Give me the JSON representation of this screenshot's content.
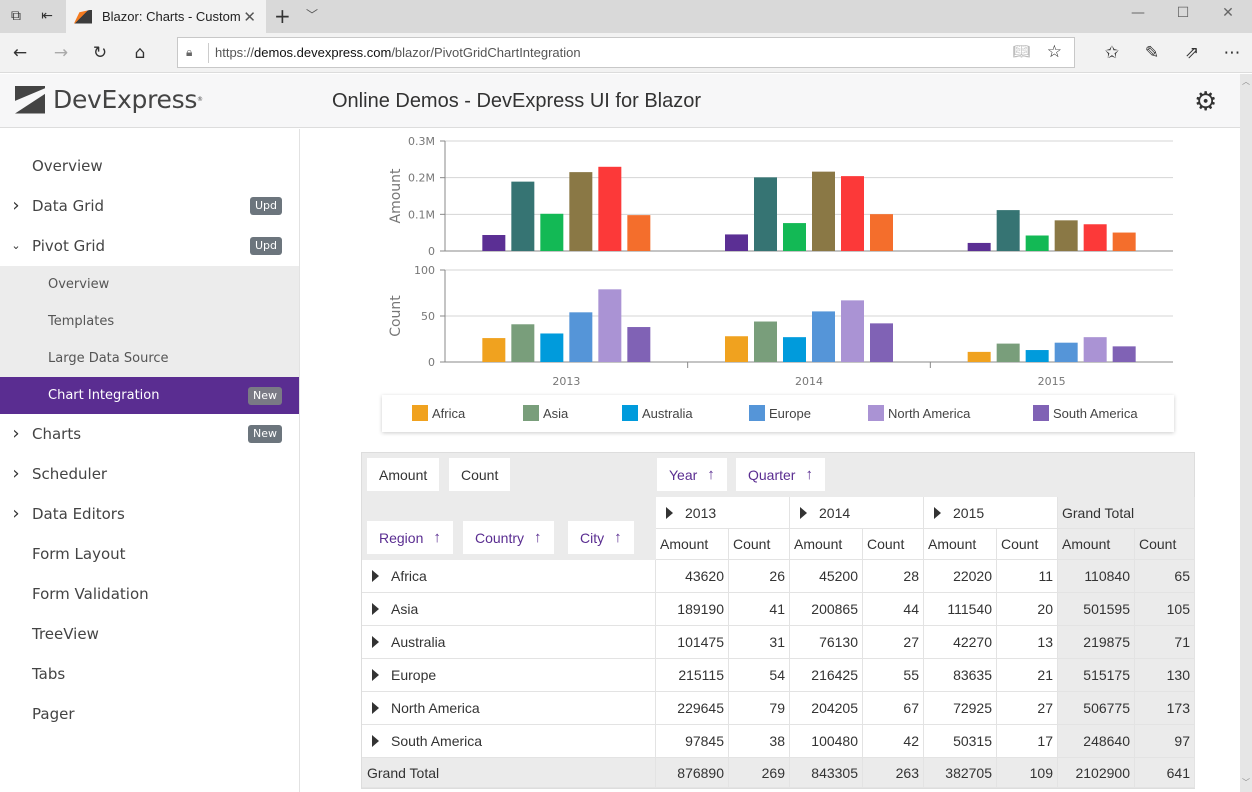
{
  "browser": {
    "tab_title": "Blazor: Charts - Custom",
    "url_prefix": "https://",
    "url_host": "demos.devexpress.com",
    "url_path": "/blazor/PivotGridChartIntegration"
  },
  "header": {
    "logo_text": "DevExpress",
    "title": "Online Demos - DevExpress UI for Blazor"
  },
  "sidebar": {
    "items": [
      {
        "label": "Overview",
        "chevron": "",
        "badge": ""
      },
      {
        "label": "Data Grid",
        "chevron": "›",
        "badge": "Upd"
      },
      {
        "label": "Pivot Grid",
        "chevron": "⌄",
        "badge": "Upd"
      },
      {
        "label": "Overview",
        "sub": true
      },
      {
        "label": "Templates",
        "sub": true
      },
      {
        "label": "Large Data Source",
        "sub": true
      },
      {
        "label": "Chart Integration",
        "sub": true,
        "active": true,
        "badge": "New"
      },
      {
        "label": "Charts",
        "chevron": "›",
        "badge": "New"
      },
      {
        "label": "Scheduler",
        "chevron": "›",
        "badge": ""
      },
      {
        "label": "Data Editors",
        "chevron": "›",
        "badge": ""
      },
      {
        "label": "Form Layout",
        "chevron": "",
        "badge": ""
      },
      {
        "label": "Form Validation",
        "chevron": "",
        "badge": ""
      },
      {
        "label": "TreeView",
        "chevron": "",
        "badge": ""
      },
      {
        "label": "Tabs",
        "chevron": "",
        "badge": ""
      },
      {
        "label": "Pager",
        "chevron": "",
        "badge": ""
      }
    ]
  },
  "chart_data": [
    {
      "type": "bar",
      "title": "",
      "ylabel": "Amount",
      "xlabel": "",
      "ylim": [
        0,
        300000
      ],
      "yticks": [
        "0",
        "0.1M",
        "0.2M",
        "0.3M"
      ],
      "ytick_values": [
        0,
        100000,
        200000,
        300000
      ],
      "grid": true,
      "categories": [
        "2013",
        "2014",
        "2015"
      ],
      "series": [
        {
          "name": "Africa",
          "color": "#5b2f94",
          "values": [
            43620,
            45200,
            22020
          ]
        },
        {
          "name": "Asia",
          "color": "#367473",
          "values": [
            189190,
            200865,
            111540
          ]
        },
        {
          "name": "Australia",
          "color": "#13b955",
          "values": [
            101475,
            76130,
            42270
          ]
        },
        {
          "name": "Europe",
          "color": "#8a7845",
          "values": [
            215115,
            216425,
            83635
          ]
        },
        {
          "name": "North America",
          "color": "#fc3939",
          "values": [
            229645,
            204205,
            72925
          ]
        },
        {
          "name": "South America",
          "color": "#f46e2c",
          "values": [
            97845,
            100480,
            50315
          ]
        }
      ]
    },
    {
      "type": "bar",
      "title": "",
      "ylabel": "Count",
      "xlabel": "",
      "ylim": [
        0,
        100
      ],
      "yticks": [
        "0",
        "50",
        "100"
      ],
      "ytick_values": [
        0,
        50,
        100
      ],
      "grid": true,
      "categories": [
        "2013",
        "2014",
        "2015"
      ],
      "legend_position": "bottom",
      "series": [
        {
          "name": "Africa",
          "color": "#f0a21f",
          "values": [
            26,
            28,
            11
          ]
        },
        {
          "name": "Asia",
          "color": "#799e7b",
          "values": [
            41,
            44,
            20
          ]
        },
        {
          "name": "Australia",
          "color": "#009bdc",
          "values": [
            31,
            27,
            13
          ]
        },
        {
          "name": "Europe",
          "color": "#5595d8",
          "values": [
            54,
            55,
            21
          ]
        },
        {
          "name": "North America",
          "color": "#aa93d4",
          "values": [
            79,
            67,
            27
          ]
        },
        {
          "name": "South America",
          "color": "#8062b5",
          "values": [
            38,
            42,
            17
          ]
        }
      ]
    }
  ],
  "legend": [
    {
      "name": "Africa",
      "color": "#f0a21f"
    },
    {
      "name": "Asia",
      "color": "#799e7b"
    },
    {
      "name": "Australia",
      "color": "#009bdc"
    },
    {
      "name": "Europe",
      "color": "#5595d8"
    },
    {
      "name": "North America",
      "color": "#aa93d4"
    },
    {
      "name": "South America",
      "color": "#8062b5"
    }
  ],
  "pivot": {
    "data_fields": [
      "Amount",
      "Count"
    ],
    "column_fields": [
      "Year",
      "Quarter"
    ],
    "row_fields": [
      "Region",
      "Country",
      "City"
    ],
    "years": [
      "2013",
      "2014",
      "2015"
    ],
    "grand_total_label": "Grand Total",
    "measure_headers": [
      "Amount",
      "Count"
    ],
    "rows": [
      {
        "label": "Africa",
        "values": [
          "43620",
          "26",
          "45200",
          "28",
          "22020",
          "11",
          "110840",
          "65"
        ]
      },
      {
        "label": "Asia",
        "values": [
          "189190",
          "41",
          "200865",
          "44",
          "111540",
          "20",
          "501595",
          "105"
        ]
      },
      {
        "label": "Australia",
        "values": [
          "101475",
          "31",
          "76130",
          "27",
          "42270",
          "13",
          "219875",
          "71"
        ]
      },
      {
        "label": "Europe",
        "values": [
          "215115",
          "54",
          "216425",
          "55",
          "83635",
          "21",
          "515175",
          "130"
        ]
      },
      {
        "label": "North America",
        "values": [
          "229645",
          "79",
          "204205",
          "67",
          "72925",
          "27",
          "506775",
          "173"
        ]
      },
      {
        "label": "South America",
        "values": [
          "97845",
          "38",
          "100480",
          "42",
          "50315",
          "17",
          "248640",
          "97"
        ]
      }
    ],
    "grand_total_row": [
      "876890",
      "269",
      "843305",
      "263",
      "382705",
      "109",
      "2102900",
      "641"
    ]
  }
}
